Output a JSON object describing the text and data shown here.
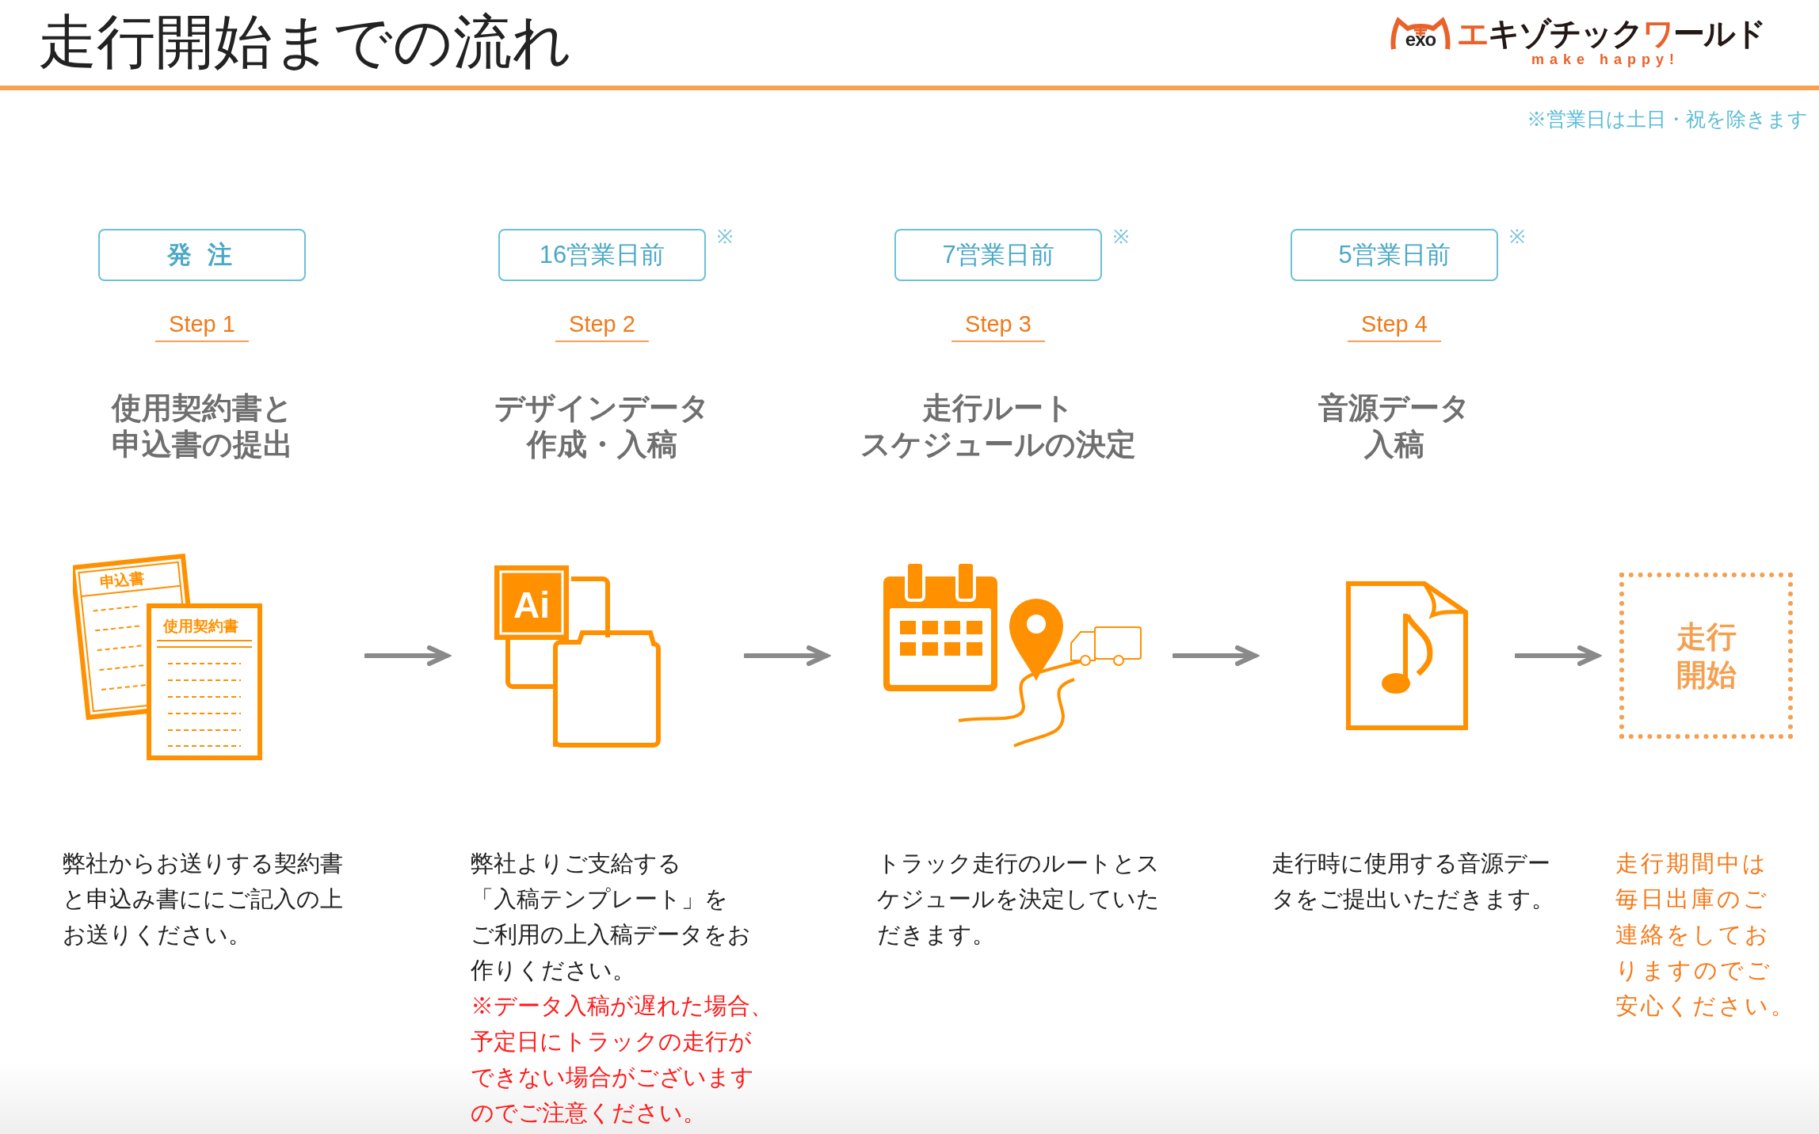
{
  "header": {
    "title": "走行開始までの流れ",
    "logo": {
      "mark": "exo",
      "name_parts": [
        {
          "text": "エ",
          "accent": true
        },
        {
          "text": "キゾチック",
          "accent": false
        },
        {
          "text": "ワ",
          "accent": true
        },
        {
          "text": "ールド",
          "accent": false
        }
      ],
      "tagline": "make happy!"
    }
  },
  "note": "※営業日は土日・祝を除きます",
  "steps": [
    {
      "badge": "発 注",
      "bold": true,
      "step": "Step 1",
      "heading": [
        "使用契約書と",
        "申込書の提出"
      ],
      "icon": {
        "kind": "documents",
        "labels": [
          "申込書",
          "使用契約書"
        ]
      },
      "description": [
        "弊社からお送りする契約書",
        "と申込み書ににご記入の上",
        "お送りください。"
      ]
    },
    {
      "badge": "16営業日前",
      "bold": false,
      "mark": "※",
      "step": "Step 2",
      "heading": [
        "デザインデータ",
        "作成・入稿"
      ],
      "icon": {
        "kind": "design",
        "labels": [
          "Ai"
        ]
      },
      "description": [
        "弊社よりご支給する",
        "「入稿テンプレート」を",
        "ご利用の上入稿データをお",
        "作りください。"
      ],
      "warning": [
        "※データ入稿が遅れた場合、",
        "予定日にトラックの走行が",
        "できない場合がございます",
        "のでご注意ください。"
      ]
    },
    {
      "badge": "7営業日前",
      "bold": false,
      "mark": "※",
      "step": "Step 3",
      "heading": [
        "走行ルート",
        "スケジュールの決定"
      ],
      "icon": {
        "kind": "route"
      },
      "description": [
        "トラック走行のルートとス",
        "ケジュールを決定していた",
        "だきます。"
      ]
    },
    {
      "badge": "5営業日前",
      "bold": false,
      "mark": "※",
      "step": "Step 4",
      "heading": [
        "音源データ",
        "入稿"
      ],
      "icon": {
        "kind": "music"
      },
      "description": [
        "走行時に使用する音源デー",
        "タをご提出いただきます。"
      ]
    }
  ],
  "finish": {
    "label": [
      "走行",
      "開始"
    ],
    "description": [
      "走行期間中は",
      "毎日出庫のご",
      "連絡をしてお",
      "りますのでご",
      "安心ください。"
    ]
  }
}
